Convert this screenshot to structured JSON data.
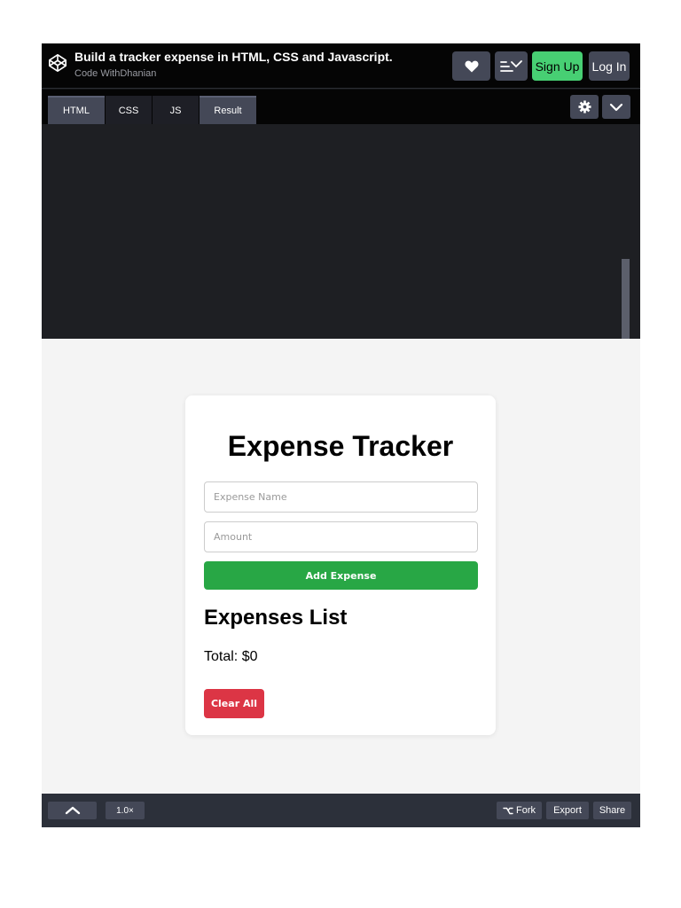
{
  "header": {
    "title": "Build a tracker expense in HTML, CSS and Javascript.",
    "author": "Code WithDhanian",
    "signup_label": "Sign Up",
    "login_label": "Log In"
  },
  "tabs": [
    {
      "label": "HTML"
    },
    {
      "label": "CSS"
    },
    {
      "label": "JS"
    },
    {
      "label": "Result"
    }
  ],
  "app": {
    "title": "Expense Tracker",
    "name_placeholder": "Expense Name",
    "amount_placeholder": "Amount",
    "add_label": "Add Expense",
    "list_title": "Expenses List",
    "total_text": "Total: $0",
    "clear_label": "Clear All"
  },
  "footer": {
    "zoom": "1.0×",
    "fork_label": "Fork",
    "export_label": "Export",
    "share_label": "Share"
  },
  "icons": {
    "logo": "codepen-logo-icon",
    "heart": "heart-icon",
    "layout": "layout-icon",
    "gear": "gear-icon",
    "chevron": "chevron-down-icon",
    "up": "chevron-up-icon",
    "fork": "fork-icon"
  },
  "colors": {
    "signup": "#47cf73",
    "add_button": "#28a745",
    "clear_button": "#dc3545",
    "button_gray": "#444857"
  }
}
